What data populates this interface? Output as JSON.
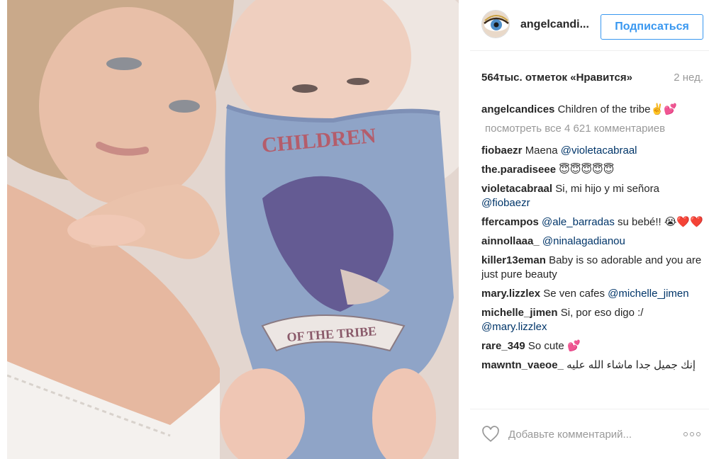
{
  "post": {
    "photo_alt": "",
    "author": "angelcandi...",
    "follow_label": "Подписаться",
    "likes": "564тыс. отметок «Нравится»",
    "time": "2 нед."
  },
  "caption": {
    "user": "angelcandices",
    "text": "Children of the tribe",
    "emoji": "✌️💕"
  },
  "view_all": "посмотреть все 4 621 комментариев",
  "comments": [
    {
      "user": "fiobaezr",
      "text": "Maena ",
      "mention": "@violetacabraal",
      "after": ""
    },
    {
      "user": "the.paradiseee",
      "text": "😇😇😇😇😇",
      "mention": "",
      "after": ""
    },
    {
      "user": "violetacabraal",
      "text": "Si, mi hijo y mi señora ",
      "mention": "@fiobaezr",
      "after": ""
    },
    {
      "user": "ffercampos",
      "text": "",
      "mention": "@ale_barradas",
      "after": " su bebé!! 😭❤️❤️"
    },
    {
      "user": "ainnollaaa_",
      "text": "",
      "mention": "@ninalagadianou",
      "after": ""
    },
    {
      "user": "killer13eman",
      "text": "Baby is so adorable and you are just pure beauty",
      "mention": "",
      "after": ""
    },
    {
      "user": "mary.lizzlex",
      "text": "Se ven cafes ",
      "mention": "@michelle_jimen",
      "after": ""
    },
    {
      "user": "michelle_jimen",
      "text": "Si, por eso digo :/ ",
      "mention": "@mary.lizzlex",
      "after": ""
    },
    {
      "user": "rare_349",
      "text": "So cute 💕",
      "mention": "",
      "after": ""
    },
    {
      "user": "mawntn_vaeoe_",
      "text": "إنك جميل جدا ماشاء الله عليه",
      "mention": "",
      "after": ""
    }
  ],
  "add_comment_placeholder": "Добавьте комментарий...",
  "colors": {
    "accent": "#3897f0",
    "mention": "#003569",
    "muted": "#999999"
  },
  "icons": {
    "like": "heart-icon",
    "more": "more-options-icon",
    "avatar": "eye-avatar"
  }
}
